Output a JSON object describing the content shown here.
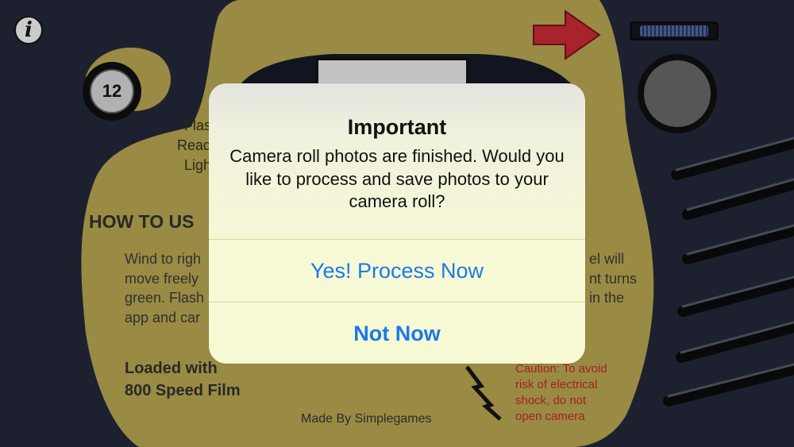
{
  "alert": {
    "title": "Important",
    "message": "Camera roll photos are finished. Would you like to process and save photos to your camera roll?",
    "primary_button": "Yes! Process Now",
    "secondary_button": "Not Now"
  },
  "camera": {
    "info_glyph": "i",
    "exposure_count": "12",
    "flash_lines": [
      "Flas",
      "Read",
      "Ligh"
    ],
    "how_to_heading": "HOW TO US",
    "instructions_left": [
      "Wind to righ",
      "move freely",
      "green. Flash",
      "app and car"
    ],
    "instructions_right": [
      "el will",
      "nt turns",
      "in the"
    ],
    "loaded_lines": [
      "Loaded with",
      "800 Speed Film"
    ],
    "made_by": "Made By Simplegames",
    "caution_lines": [
      "Caution: To avoid",
      "risk of electrical",
      "shock, do not",
      "open camera"
    ]
  },
  "colors": {
    "body_tan": "#a39449",
    "camera_dark": "#1f2432",
    "alert_link": "#1a7ae6",
    "arrow_red": "#b3262e",
    "caution_red": "#b02222"
  },
  "icons": {
    "info": "info-icon",
    "arrow": "red-arrow-icon",
    "lightning": "lightning-icon",
    "wind_wheel": "film-wind-wheel",
    "lens": "flash-lens",
    "grille": "grille-slats"
  }
}
